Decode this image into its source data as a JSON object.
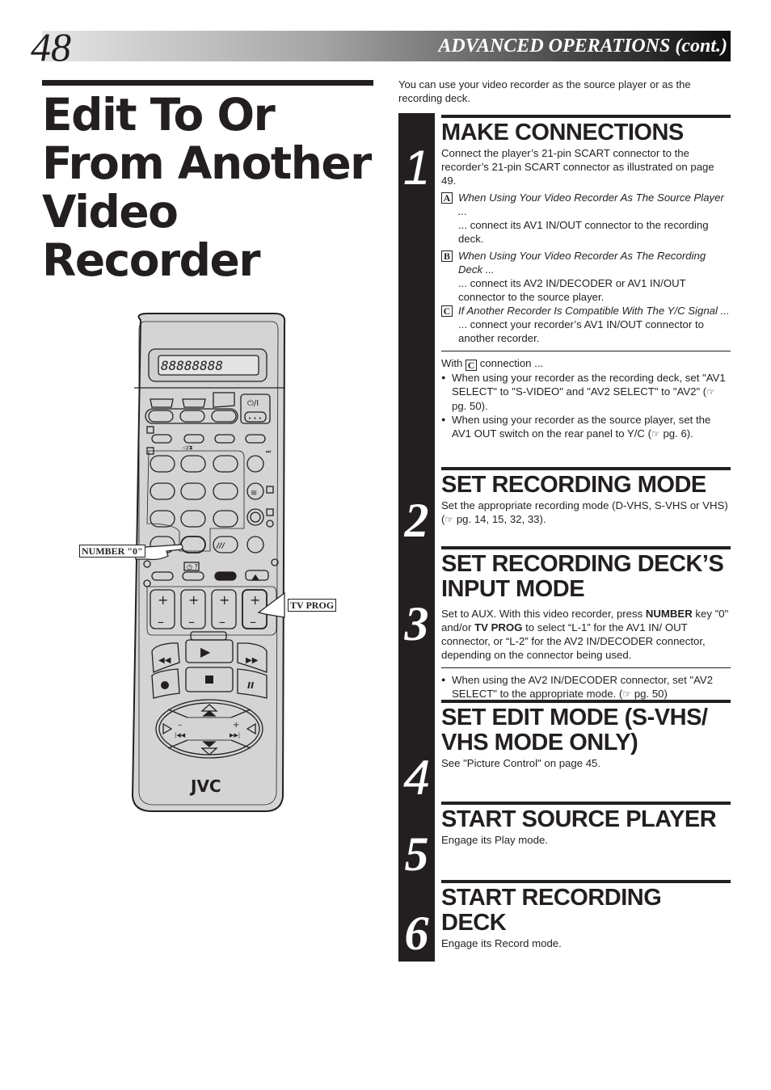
{
  "header": {
    "page_number": "48",
    "section_title": "ADVANCED OPERATIONS (cont.)"
  },
  "title": {
    "lines": [
      "Edit To Or",
      "From Another",
      "Video",
      "Recorder"
    ]
  },
  "illustration": {
    "brand": "JVC",
    "display_text": "88888888",
    "callouts": {
      "number_zero": "NUMBER \"0\"",
      "tv_prog": "TV PROG"
    },
    "power_label": "⏻/I",
    "dots_label": "•••"
  },
  "intro": "You can use your video recorder as the source player or as the recording deck.",
  "steps": [
    {
      "number": "1",
      "heading": "MAKE CONNECTIONS",
      "body": "Connect the player’s 21-pin SCART connector to the recorder’s 21-pin SCART connector as illustrated on page 49.",
      "items": [
        {
          "letter": "A",
          "title": "When Using Your Video Recorder As The Source Player ...",
          "text": "... connect its AV1 IN/OUT connector to the recording deck."
        },
        {
          "letter": "B",
          "title": "When Using Your Video Recorder As The Recording Deck ...",
          "text": "... connect its AV2 IN/DECODER or AV1 IN/OUT connector to the source player."
        },
        {
          "letter": "C",
          "title": "If Another Recorder Is Compatible With The Y/C Signal ...",
          "text": "... connect your recorder’s AV1 IN/OUT connector to another recorder."
        }
      ],
      "note_intro_pre": "With",
      "note_intro_letter": "C",
      "note_intro_post": "connection ...",
      "notes": [
        {
          "pre": "When using your recorder as the recording deck, set \"AV1 SELECT\" to \"S-VIDEO\" and \"AV2 SELECT\" to \"AV2\" (",
          "ref": "☞",
          "post": " pg. 50)."
        },
        {
          "pre": "When using your recorder as the source player, set the AV1 OUT switch on the rear panel to Y/C (",
          "ref": "☞",
          "post": " pg. 6)."
        }
      ]
    },
    {
      "number": "2",
      "heading": "SET RECORDING MODE",
      "body_pre": "Set the appropriate recording mode (D-VHS, S-VHS or VHS) (",
      "ref": "☞",
      "body_post": " pg. 14, 15, 32, 33)."
    },
    {
      "number": "3",
      "heading": "SET RECORDING DECK’S INPUT MODE",
      "body_a": "Set to AUX. With this video recorder, press ",
      "bold_a": "NUMBER",
      "body_b": " key \"0\" and/or ",
      "bold_b": "TV PROG",
      "body_c": " to select “L-1” for the AV1 IN/ OUT connector, or “L-2” for the AV2 IN/DECODER connector,  depending on the connector being used.",
      "note_pre": "When using the AV2 IN/DECODER connector, set \"AV2 SELECT\" to the appropriate mode. (",
      "ref": "☞",
      "note_post": " pg. 50)"
    },
    {
      "number": "4",
      "heading": "SET EDIT MODE (S-VHS/ VHS MODE ONLY)",
      "body": "See \"Picture Control\" on page 45."
    },
    {
      "number": "5",
      "heading": "START SOURCE PLAYER",
      "body": "Engage its Play mode."
    },
    {
      "number": "6",
      "heading": "START RECORDING DECK",
      "body": "Engage its Record mode."
    }
  ]
}
